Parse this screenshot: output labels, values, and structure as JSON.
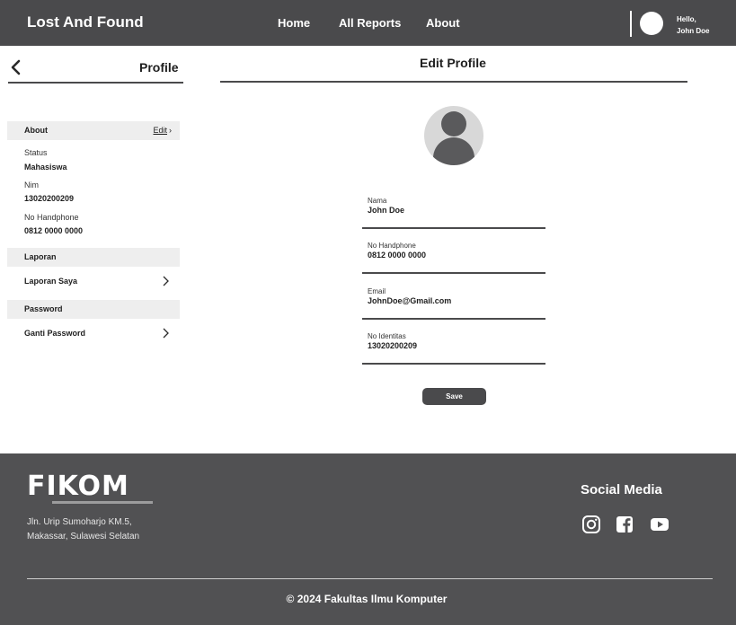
{
  "navbar": {
    "brand": "Lost And Found",
    "links": [
      "Home",
      "All Reports",
      "About"
    ],
    "greeting": "Hello,",
    "username": "John Doe"
  },
  "sidebar": {
    "title": "Profile",
    "about": {
      "heading": "About",
      "edit_label": "Edit",
      "fields": [
        {
          "label": "Status",
          "value": "Mahasiswa"
        },
        {
          "label": "Nim",
          "value": "13020200209"
        },
        {
          "label": "No Handphone",
          "value": "0812 0000 0000"
        }
      ]
    },
    "laporan": {
      "heading": "Laporan",
      "item": "Laporan Saya"
    },
    "password": {
      "heading": "Password",
      "item": "Ganti Password"
    }
  },
  "main": {
    "title": "Edit Profile",
    "fields": [
      {
        "label": "Nama",
        "value": "John Doe"
      },
      {
        "label": "No Handphone",
        "value": "0812 0000 0000"
      },
      {
        "label": "Email",
        "value": "JohnDoe@Gmail.com"
      },
      {
        "label": "No Identitas",
        "value": "13020200209"
      }
    ],
    "save_label": "Save"
  },
  "footer": {
    "logo_text": "FIKOM",
    "address_line1": "Jln. Urip Sumoharjo KM.5,",
    "address_line2": "Makassar, Sulawesi Selatan",
    "social_title": "Social Media",
    "social_icons": [
      "instagram-icon",
      "facebook-icon",
      "youtube-icon"
    ],
    "copyright": "© 2024 Fakultas Ilmu Komputer"
  },
  "colors": {
    "navbar": "#4a4a4c",
    "footer": "#515153",
    "section_bg": "#eeeeee",
    "avatar_bg": "#d8d8d8"
  }
}
